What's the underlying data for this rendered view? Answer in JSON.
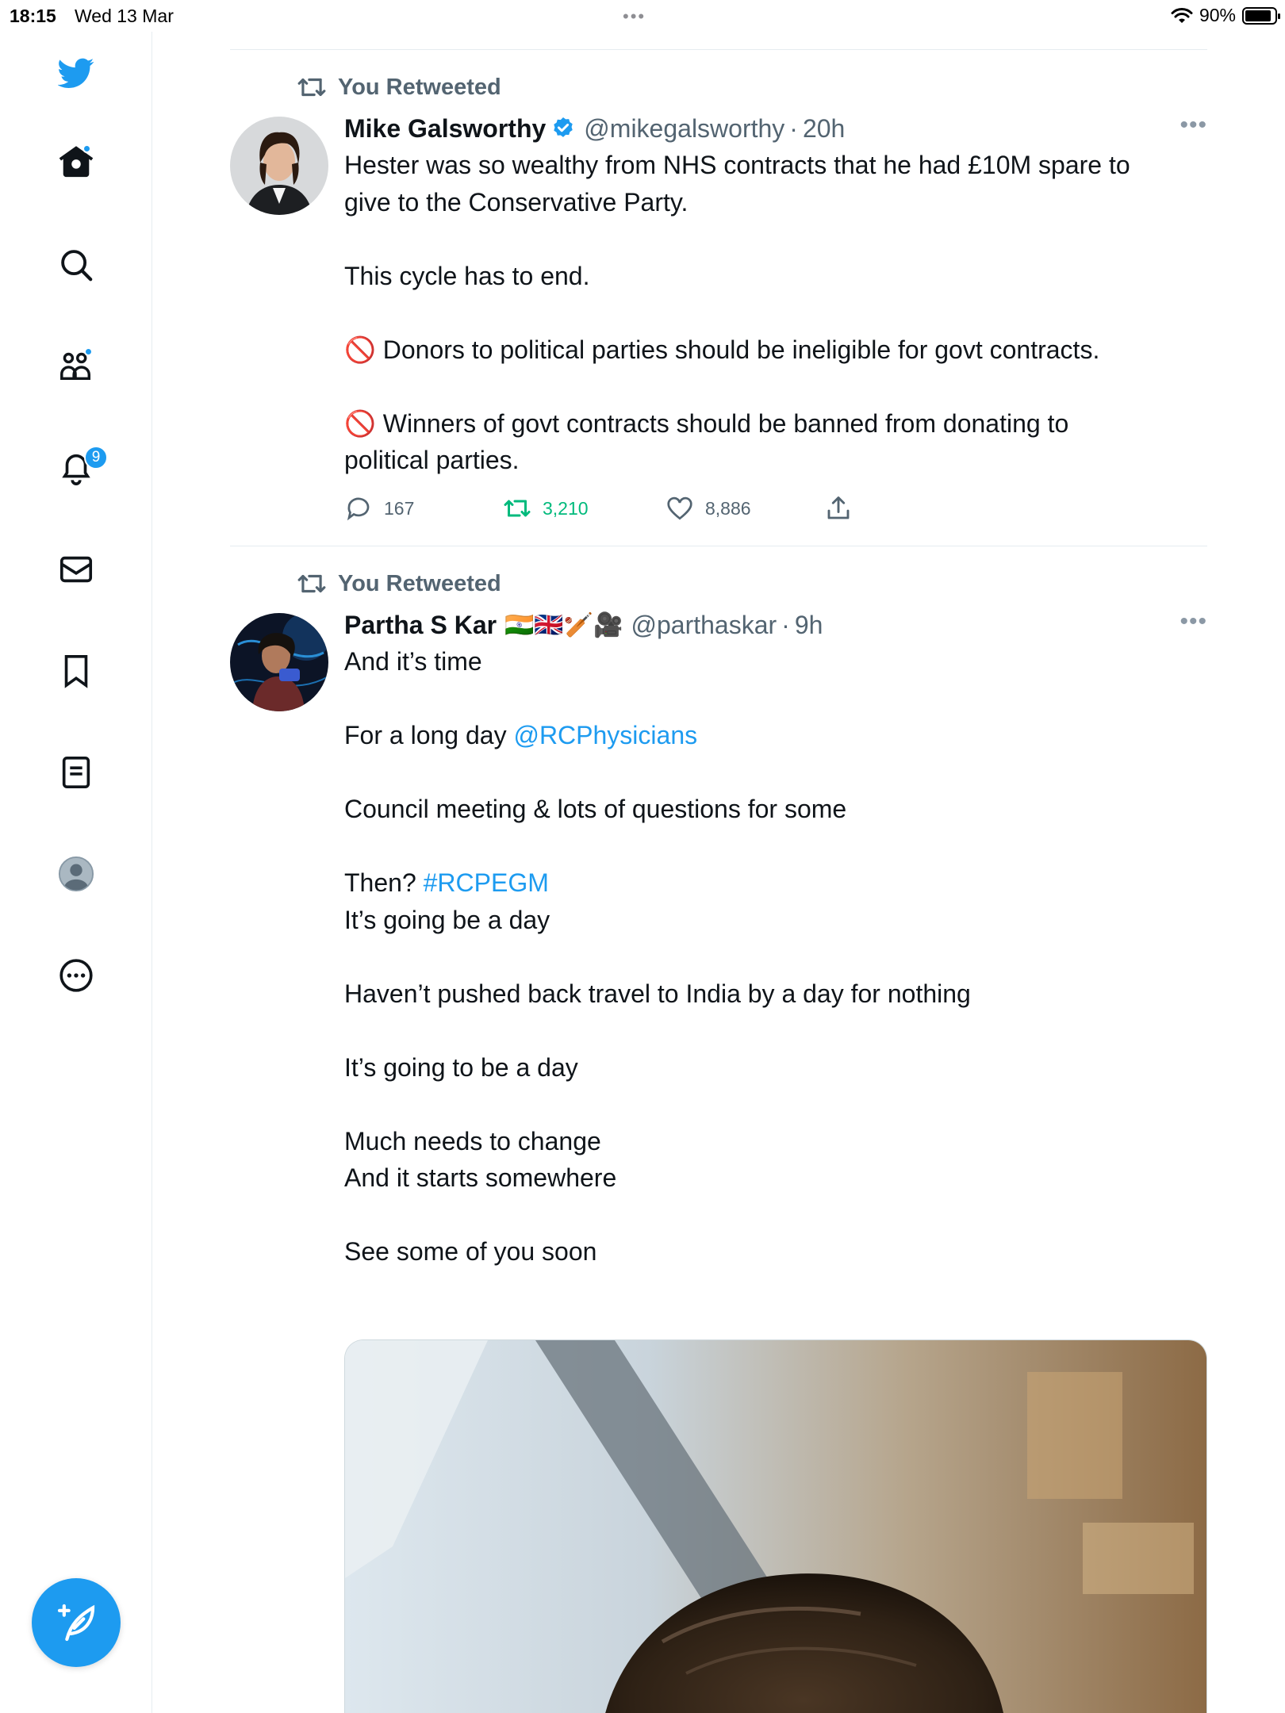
{
  "status_bar": {
    "time": "18:15",
    "date": "Wed 13 Mar",
    "multitask": "•••",
    "battery": "90%",
    "battery_level": 0.9
  },
  "sidebar": {
    "logo": "twitter-bird-icon",
    "items": [
      {
        "icon": "home-icon",
        "dot": true
      },
      {
        "icon": "search-icon"
      },
      {
        "icon": "communities-icon",
        "dot": true
      },
      {
        "icon": "bell-icon",
        "badge": "9"
      },
      {
        "icon": "mail-icon"
      },
      {
        "icon": "bookmark-icon"
      },
      {
        "icon": "list-icon"
      },
      {
        "icon": "profile-icon"
      },
      {
        "icon": "more-circle-icon"
      }
    ],
    "compose": "compose-tweet-icon"
  },
  "colors": {
    "accent": "#1d9bf0",
    "retweet_green": "#00ba7c",
    "muted": "#536471"
  },
  "tweets": [
    {
      "retweet_label": "You Retweeted",
      "name": "Mike Galsworthy",
      "verified": true,
      "handle": "@mikegalsworthy",
      "time": "20h",
      "lines": [
        "Hester was so wealthy from NHS contracts that he had £10M spare to",
        "give to the Conservative Party.",
        "",
        "This cycle has to end.",
        "",
        "🚫 Donors to political parties should be ineligible for govt contracts.",
        "",
        "🚫 Winners of govt contracts should be banned from donating to",
        "political parties."
      ],
      "replies": "167",
      "retweets": "3,210",
      "likes": "8,886"
    },
    {
      "retweet_label": "You Retweeted",
      "name": "Partha S Kar",
      "name_emoji": "🇮🇳🇬🇧🏏🎥",
      "handle": "@parthaskar",
      "time": "9h",
      "line1": "And it’s time",
      "line2_prefix": "For a long day ",
      "mention": "@RCPhysicians",
      "line3": "Council meeting & lots of questions for some",
      "line4_prefix": "Then? ",
      "hashtag": "#RCPEGM",
      "line5": "It’s going be a day",
      "line6": "Haven’t pushed back travel to India by a day for nothing",
      "line7": "It’s going to be a day",
      "line8": "Much needs to change",
      "line9": "And it starts somewhere",
      "line10": "See some of you soon"
    }
  ]
}
